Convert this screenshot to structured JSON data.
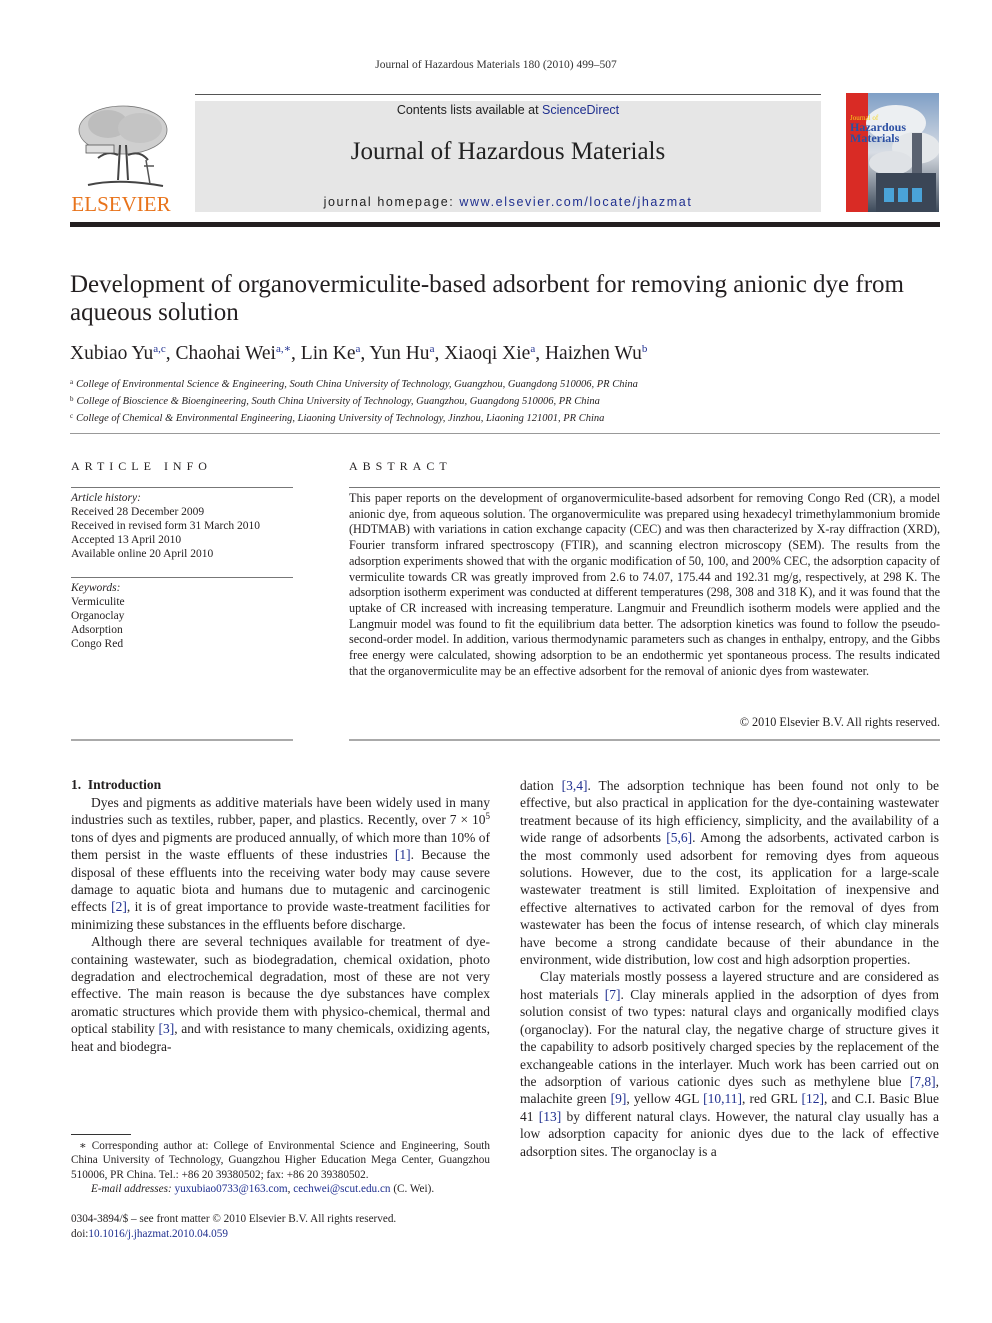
{
  "running_head": "Journal of Hazardous Materials 180 (2010) 499–507",
  "masthead": {
    "publisher_logo_text": "ELSEVIER",
    "contents_prefix": "Contents lists available at ",
    "contents_link": "ScienceDirect",
    "journal_title": "Journal of Hazardous Materials",
    "homepage_prefix": "journal homepage: ",
    "homepage_link": "www.elsevier.com/locate/jhazmat",
    "cover_title_line1": "Journal of",
    "cover_title_line2": "Hazardous",
    "cover_title_line3": "Materials",
    "brand_orange": "#e8731b",
    "link_color": "#1f2f8f"
  },
  "article": {
    "title": "Development of organovermiculite-based adsorbent for removing anionic dye from aqueous solution",
    "authors": [
      {
        "name": "Xubiao Yu",
        "sup": "a,c",
        "sep": ", "
      },
      {
        "name": "Chaohai Wei",
        "sup": "a,∗",
        "sep": ", "
      },
      {
        "name": "Lin Ke",
        "sup": "a",
        "sep": ", "
      },
      {
        "name": "Yun Hu",
        "sup": "a",
        "sep": ", "
      },
      {
        "name": "Xiaoqi Xie",
        "sup": "a",
        "sep": ", "
      },
      {
        "name": "Haizhen Wu",
        "sup": "b",
        "sep": ""
      }
    ],
    "affiliations": [
      {
        "key": "a",
        "text": "College of Environmental Science & Engineering, South China University of Technology, Guangzhou, Guangdong 510006, PR China"
      },
      {
        "key": "b",
        "text": "College of Bioscience & Bioengineering, South China University of Technology, Guangzhou, Guangdong 510006, PR China"
      },
      {
        "key": "c",
        "text": "College of Chemical & Environmental Engineering, Liaoning University of Technology, Jinzhou, Liaoning 121001, PR China"
      }
    ]
  },
  "article_info": {
    "heading": "ARTICLE INFO",
    "history_label": "Article history:",
    "history": [
      "Received 28 December 2009",
      "Received in revised form 31 March 2010",
      "Accepted 13 April 2010",
      "Available online 20 April 2010"
    ],
    "keywords_label": "Keywords:",
    "keywords": [
      "Vermiculite",
      "Organoclay",
      "Adsorption",
      "Congo Red"
    ]
  },
  "abstract": {
    "heading": "ABSTRACT",
    "text": "This paper reports on the development of organovermiculite-based adsorbent for removing Congo Red (CR), a model anionic dye, from aqueous solution. The organovermiculite was prepared using hexadecyl trimethylammonium bromide (HDTMAB) with variations in cation exchange capacity (CEC) and was then characterized by X-ray diffraction (XRD), Fourier transform infrared spectroscopy (FTIR), and scanning electron microscopy (SEM). The results from the adsorption experiments showed that with the organic modification of 50, 100, and 200% CEC, the adsorption capacity of vermiculite towards CR was greatly improved from 2.6 to 74.07, 175.44 and 192.31 mg/g, respectively, at 298 K. The adsorption isotherm experiment was conducted at different temperatures (298, 308 and 318 K), and it was found that the uptake of CR increased with increasing temperature. Langmuir and Freundlich isotherm models were applied and the Langmuir model was found to fit the equilibrium data better. The adsorption kinetics was found to follow the pseudo-second-order model. In addition, various thermodynamic parameters such as changes in enthalpy, entropy, and the Gibbs free energy were calculated, showing adsorption to be an endothermic yet spontaneous process. The results indicated that the organovermiculite may be an effective adsorbent for the removal of anionic dyes from wastewater.",
    "copyright": "© 2010 Elsevier B.V. All rights reserved."
  },
  "body": {
    "section_heading": "1.  Introduction",
    "left": {
      "p1_a": "Dyes and pigments as additive materials have been widely used in many industries such as textiles, rubber, paper, and plastics. Recently, over 7 × 10",
      "p1_sup": "5",
      "p1_b": " tons of dyes and pigments are produced annually, of which more than 10% of them persist in the waste effluents of these industries ",
      "p1_ref1": "[1]",
      "p1_c": ". Because the disposal of these effluents into the receiving water body may cause severe damage to aquatic biota and humans due to mutagenic and carcinogenic effects ",
      "p1_ref2": "[2]",
      "p1_d": ", it is of great importance to provide waste-treatment facilities for minimizing these substances in the effluents before discharge.",
      "p2_a": "Although there are several techniques available for treatment of dye-containing wastewater, such as biodegradation, chemical oxidation, photo degradation and electrochemical degradation, most of these are not very effective. The main reason is because the dye substances have complex aromatic structures which provide them with physico-chemical, thermal and optical stability ",
      "p2_ref": "[3]",
      "p2_b": ", and with resistance to many chemicals, oxidizing agents, heat and biodegra-"
    },
    "right": {
      "p1_a": "dation ",
      "p1_ref1": "[3,4]",
      "p1_b": ". The adsorption technique has been found not only to be effective, but also practical in application for the dye-containing wastewater treatment because of its high efficiency, simplicity, and the availability of a wide range of adsorbents ",
      "p1_ref2": "[5,6]",
      "p1_c": ". Among the adsorbents, activated carbon is the most commonly used adsorbent for removing dyes from aqueous solutions. However, due to the cost, its application for a large-scale wastewater treatment is still limited. Exploitation of inexpensive and effective alternatives to activated carbon for the removal of dyes from wastewater has been the focus of intense research, of which clay minerals have become a strong candidate because of their abundance in the environment, wide distribution, low cost and high adsorption properties.",
      "p2_a": "Clay materials mostly possess a layered structure and are considered as host materials ",
      "p2_ref1": "[7]",
      "p2_b": ". Clay minerals applied in the adsorption of dyes from solution consist of two types: natural clays and organically modified clays (organoclay). For the natural clay, the negative charge of structure gives it the capability to adsorb positively charged species by the replacement of the exchangeable cations in the interlayer. Much work has been carried out on the adsorption of various cationic dyes such as methylene blue ",
      "p2_ref2": "[7,8]",
      "p2_c": ", malachite green ",
      "p2_ref3": "[9]",
      "p2_d": ", yellow 4GL ",
      "p2_ref4": "[10,11]",
      "p2_e": ", red GRL ",
      "p2_ref5": "[12]",
      "p2_f": ", and C.I. Basic Blue 41 ",
      "p2_ref6": "[13]",
      "p2_g": " by different natural clays. However, the natural clay usually has a low adsorption capacity for anionic dyes due to the lack of effective adsorption sites. The organoclay is a"
    }
  },
  "footnote": {
    "corresponding": "∗ Corresponding author at: College of Environmental Science and Engineering, South China University of Technology, Guangzhou Higher Education Mega Center, Guangzhou 510006, PR China. Tel.: +86 20 39380502; fax: +86 20 39380502.",
    "email_label": "E-mail addresses: ",
    "email1": "yuxubiao0733@163.com",
    "email_sep": ", ",
    "email2": "cechwei@scut.edu.cn",
    "email_suffix": " (C. Wei).",
    "issn_line": "0304-3894/$ – see front matter © 2010 Elsevier B.V. All rights reserved.",
    "doi_prefix": "doi:",
    "doi_link": "10.1016/j.jhazmat.2010.04.059"
  }
}
